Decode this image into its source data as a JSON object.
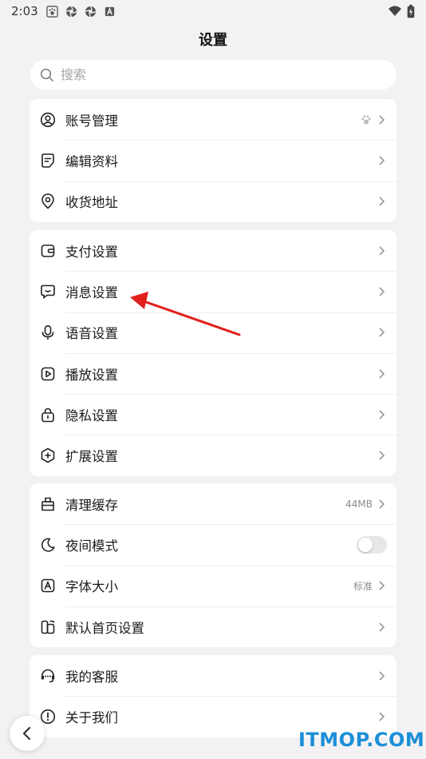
{
  "status_bar": {
    "time": "2:03"
  },
  "header": {
    "title": "设置"
  },
  "search": {
    "placeholder": "搜索"
  },
  "groups": [
    {
      "items": [
        {
          "label": "账号管理",
          "icon": "user-circle-icon",
          "extra": "paw-icon"
        },
        {
          "label": "编辑资料",
          "icon": "edit-note-icon"
        },
        {
          "label": "收货地址",
          "icon": "location-pin-icon"
        }
      ]
    },
    {
      "items": [
        {
          "label": "支付设置",
          "icon": "wallet-icon"
        },
        {
          "label": "消息设置",
          "icon": "message-icon"
        },
        {
          "label": "语音设置",
          "icon": "microphone-icon"
        },
        {
          "label": "播放设置",
          "icon": "play-icon"
        },
        {
          "label": "隐私设置",
          "icon": "lock-icon"
        },
        {
          "label": "扩展设置",
          "icon": "extension-icon"
        }
      ]
    },
    {
      "items": [
        {
          "label": "清理缓存",
          "icon": "broom-icon",
          "value": "44MB"
        },
        {
          "label": "夜间模式",
          "icon": "moon-icon",
          "toggle": false
        },
        {
          "label": "字体大小",
          "icon": "font-size-icon",
          "value": "标准"
        },
        {
          "label": "默认首页设置",
          "icon": "home-layout-icon"
        }
      ]
    },
    {
      "items": [
        {
          "label": "我的客服",
          "icon": "headset-icon"
        },
        {
          "label": "关于我们",
          "icon": "info-icon"
        }
      ]
    }
  ],
  "watermark": "ITMOP.COM",
  "colors": {
    "background": "#f2f2f4",
    "card": "#ffffff",
    "annotation_arrow": "#e0201c",
    "watermark": "#1b8fd8"
  }
}
